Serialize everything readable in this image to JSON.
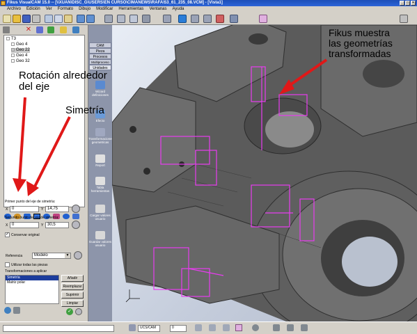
{
  "window": {
    "title": "Fikus VisualCAM 15.0 -- [\\\\XUAN\\DISC_G\\USERS\\EN CURSO\\CIMANEWS\\RAFA\\53_61_235_08.VCM] - [Vista1]",
    "icon": "app-icon"
  },
  "menu": [
    "Archivo",
    "Edición",
    "Ver",
    "Formato",
    "Dibujo",
    "Modificar",
    "Herramientas",
    "Ventanas",
    "Ayuda"
  ],
  "tree": {
    "root": "T3",
    "items": [
      "Geo 4",
      "Geo 22",
      "Geo 4",
      "Geo 32"
    ],
    "selected_index": 1
  },
  "side_tabs": [
    "CAM",
    "Pieza",
    "Procesos",
    "Multiproceso",
    "Unidades"
  ],
  "side_buttons": [
    "Wizard definiciones",
    "Efecto",
    "Transformaciones geometricas",
    "Report",
    "Tabla herramientas",
    "Cargar valores usuario",
    "Guardar valores usuario"
  ],
  "symmetry": {
    "point1_label": "Primer punto del eje de simetría:",
    "point1_x": "0",
    "point1_y": "14,75",
    "point2_label": "Segundo punto del eje de simetría:",
    "point2_x": "0",
    "point2_y": "30,5",
    "x_label": "X",
    "y_label": "Y",
    "keep_original_label": "Conservar original",
    "keep_original_checked": true
  },
  "reference": {
    "label": "Referencia",
    "value": "Modelo",
    "use_all_label": "Utilizar todas las piezas",
    "use_all_checked": false
  },
  "transforms": {
    "label": "Transformaciones a aplicar",
    "items": [
      "Simetría",
      "Matriz polar"
    ],
    "selected_index": 0,
    "buttons": [
      "Añadir",
      "Reemplazar",
      "Suprimir",
      "Limpiar"
    ]
  },
  "statusbar": {
    "ucs_value": "UCS/CAM",
    "layer_value": "0"
  },
  "annotations": {
    "rotation": "Rotación alrededor\ndel eje",
    "symmetry": "Simetría",
    "fikus": "Fikus muestra\nlas geometrías\ntransformadas"
  },
  "colors": {
    "title_blue": "#1c4fb8",
    "highlight_magenta": "#e83cf0",
    "arrow_red": "#e01818",
    "part_gray": "#555555"
  }
}
